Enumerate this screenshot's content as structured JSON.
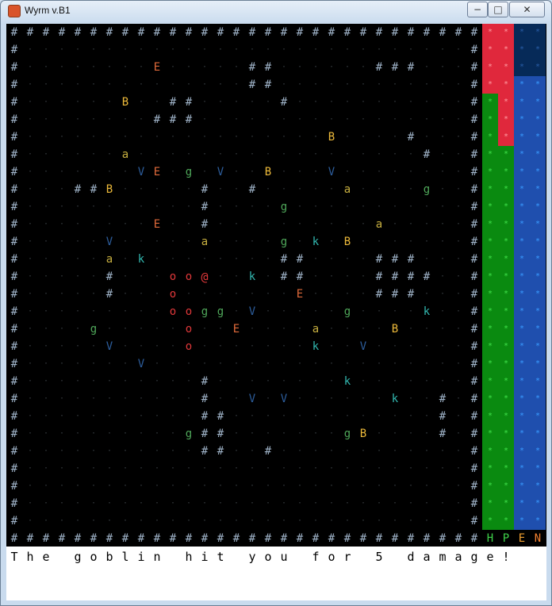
{
  "window": {
    "title": "Wyrm    v.B1",
    "minimize_glyph": "−",
    "maximize_glyph": "□",
    "close_glyph": "✕"
  },
  "colors": {
    "wall": "#9fb3c8",
    "floor": "#3b4046",
    "player": "#e0383a",
    "snake": "#e0383a",
    "E": "#e06a3a",
    "B": "#ecb93a",
    "g": "#4fa85a",
    "a": "#c8b040",
    "k": "#32b8b0",
    "V": "#2c5c9a",
    "bar_hp": "#e0283c",
    "bar_p": "#0a8a10",
    "bar_e": "#1f4fae",
    "bar_n": "#062a58",
    "bar_star": "#0d7a10",
    "legend_H": "#3fd24a",
    "legend_P": "#3fd24a",
    "legend_E": "#f0a030",
    "legend_N": "#f08030"
  },
  "map": {
    "rows": [
      "##############################",
      "#                            #",
      "#        E     ##      ###   #",
      "#              ##            #",
      "#      B  ##     #           #",
      "#        ###                 #",
      "#                   B    #   #",
      "#      a                  #  ##",
      "#       VE g V  B   V        #",
      "#   ##B     #  #     a    g  #",
      "#           #    g           #",
      "#        E  #          a     #",
      "#     V     a    g k B       #",
      "#     a k        ##    ###   #",
      "#     #   oo@  k ##    ####  #",
      "#     #   o       E    ###   #",
      "#         oogg V     g    k  #",
      "#    g     o  E    a    B    #",
      "#     V    o       k  V      #",
      "#       V                    #",
      "#           #        k       #",
      "#           #  V V      k  # #",
      "#           ##             # #",
      "#          g##       gB    # #",
      "#           ##  #            #",
      "#                            #",
      "#                            #",
      "#                            #",
      "#                            #",
      "##############################"
    ]
  },
  "sidebar": {
    "star": "*",
    "bars": [
      {
        "key": "H",
        "filled_fraction": 0.14
      },
      {
        "key": "P",
        "filled_fraction": 0.79
      },
      {
        "key": "E",
        "filled_fraction": 0.91
      },
      {
        "key": "N",
        "filled_fraction": 0.09
      }
    ],
    "legend": [
      "H",
      "P",
      "E",
      "N"
    ]
  },
  "message": {
    "text": "The goblin hit you for 5 damage!"
  }
}
